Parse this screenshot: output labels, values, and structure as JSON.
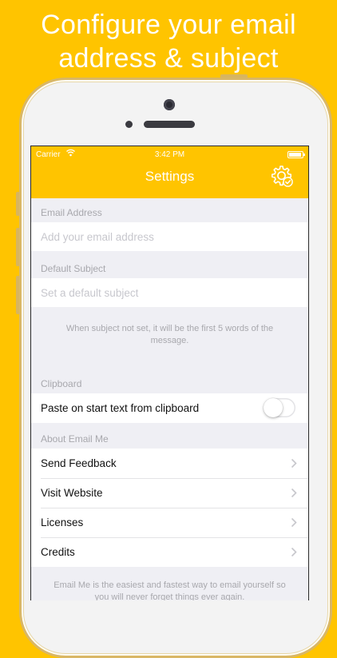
{
  "headline": {
    "line1": "Configure your email",
    "line2": "address & subject"
  },
  "status_bar": {
    "carrier": "Carrier",
    "time": "3:42 PM"
  },
  "nav": {
    "title": "Settings",
    "icon": "gear-check-icon"
  },
  "email_section": {
    "header": "Email Address",
    "placeholder": "Add your email address"
  },
  "subject_section": {
    "header": "Default Subject",
    "placeholder": "Set a default subject",
    "footer": "When subject not set, it will be the first 5 words of the message."
  },
  "clipboard_section": {
    "header": "Clipboard",
    "toggle_label": "Paste on start text from clipboard",
    "toggle_on": false
  },
  "about_section": {
    "header": "About Email Me",
    "items": [
      {
        "label": "Send Feedback"
      },
      {
        "label": "Visit Website"
      },
      {
        "label": "Licenses"
      },
      {
        "label": "Credits"
      }
    ],
    "footer": "Email Me is the easiest and fastest way to email yourself so you will never forget things ever again."
  },
  "colors": {
    "accent": "#ffc400",
    "background": "#efeff4",
    "secondary_text": "#a8a8ad"
  }
}
